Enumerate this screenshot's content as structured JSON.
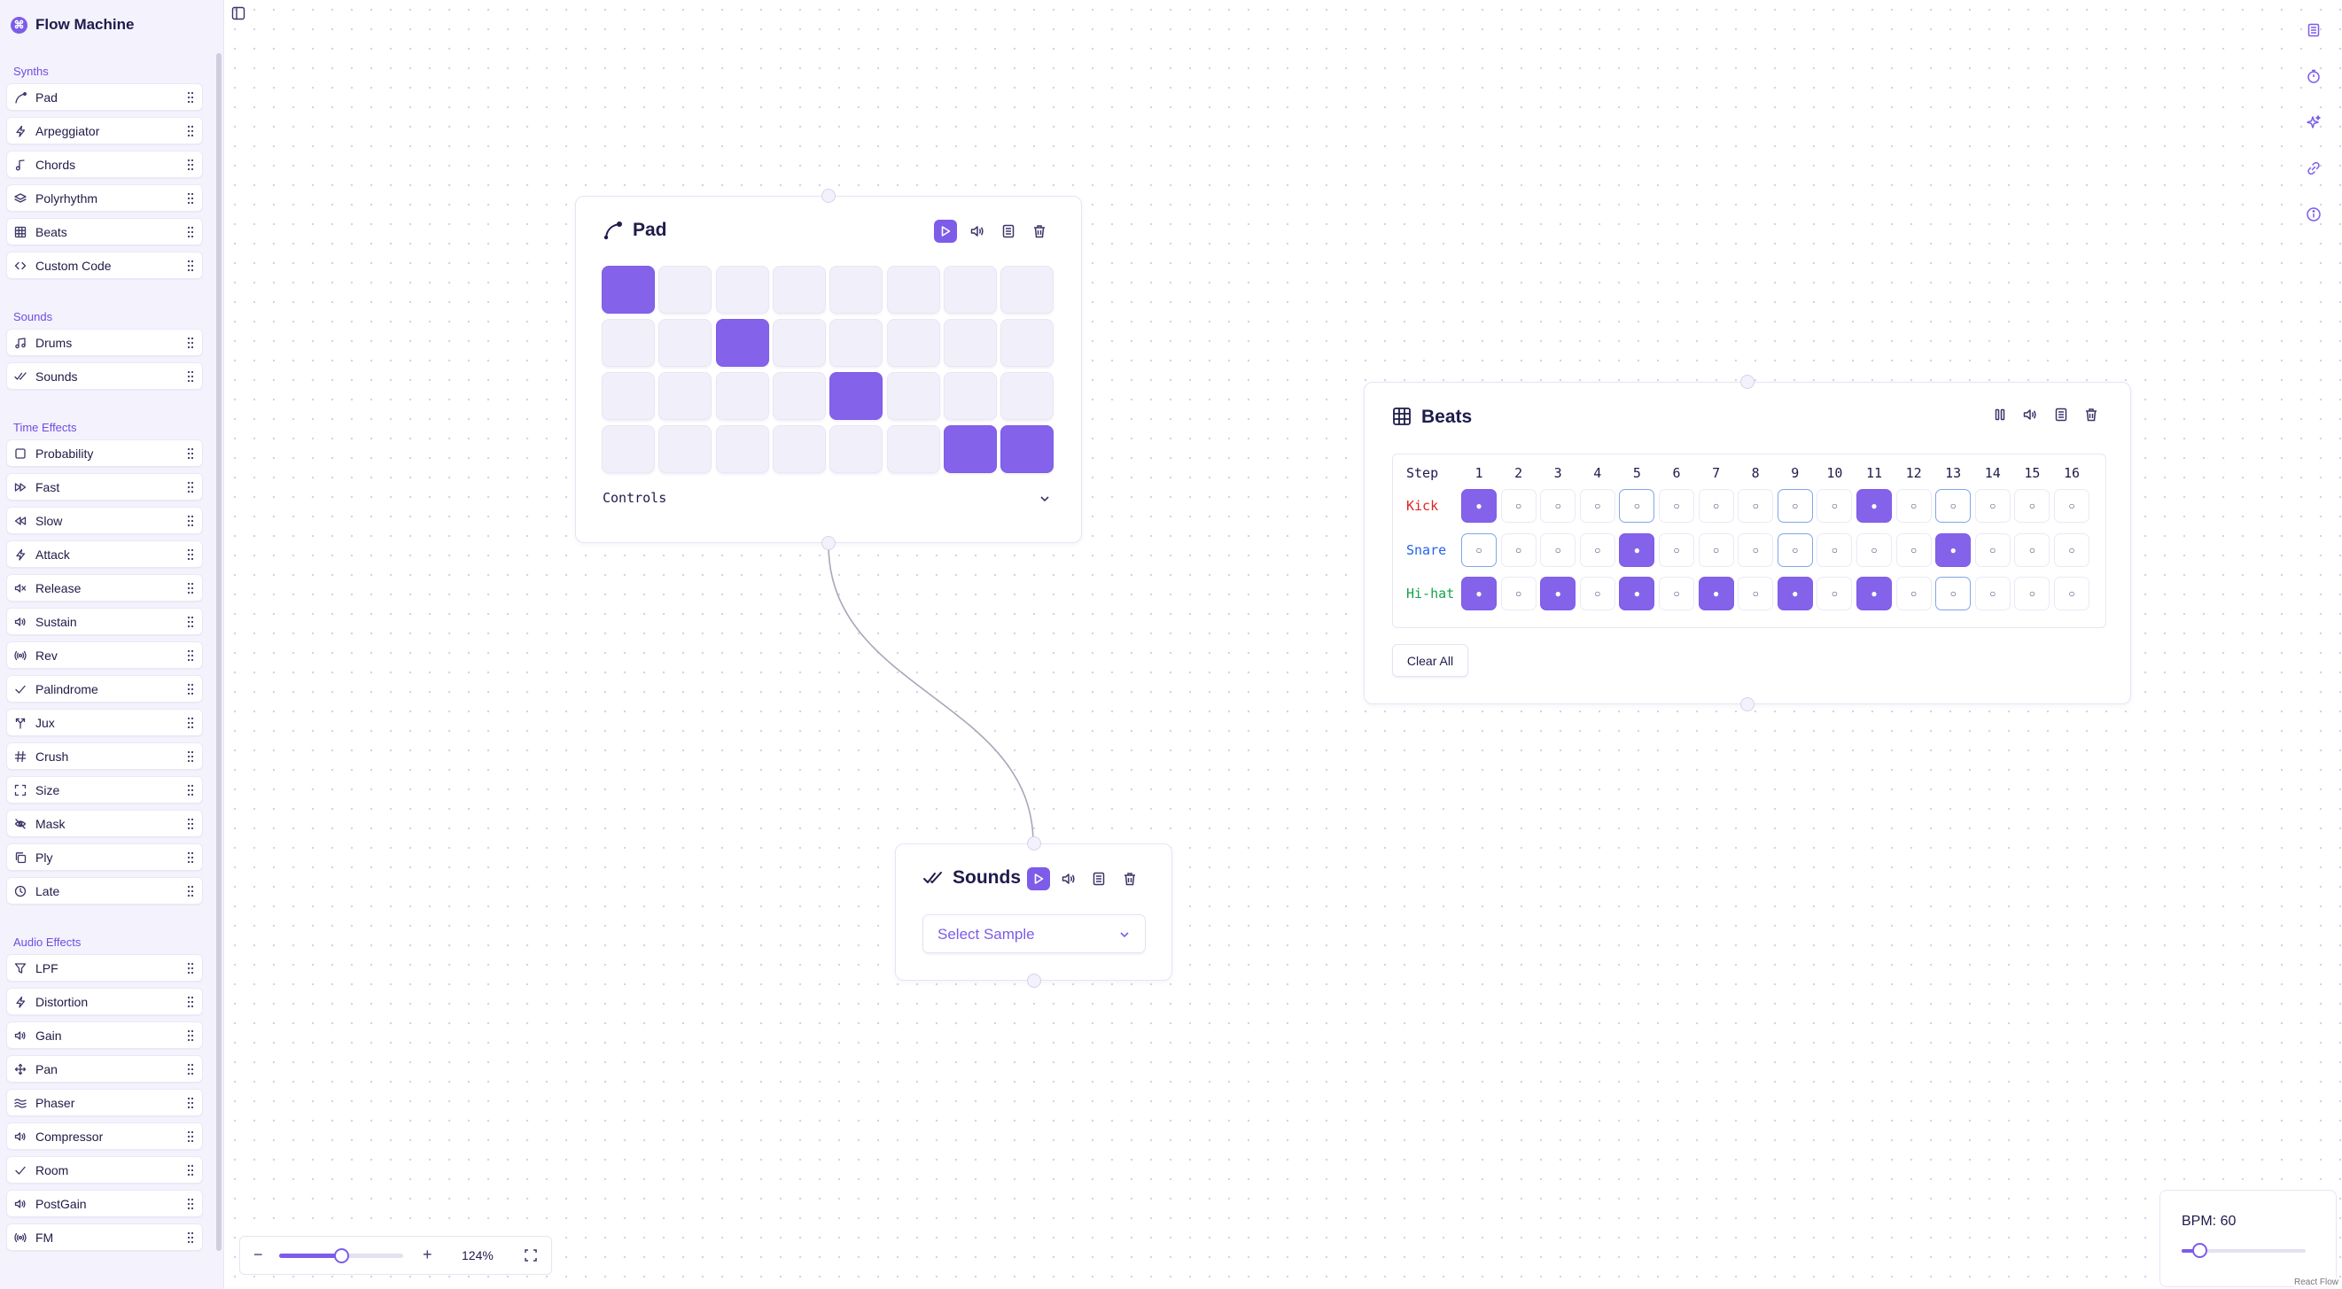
{
  "app": {
    "title": "Flow Machine",
    "logo_glyph": "⌘",
    "accent": "#7c5ce8"
  },
  "sidebar": {
    "sections": [
      {
        "title": "Synths",
        "items": [
          {
            "label": "Pad",
            "icon": "pen-curve-icon"
          },
          {
            "label": "Arpeggiator",
            "icon": "zap-icon"
          },
          {
            "label": "Chords",
            "icon": "music-note-icon"
          },
          {
            "label": "Polyrhythm",
            "icon": "layers-icon"
          },
          {
            "label": "Beats",
            "icon": "grid-icon"
          },
          {
            "label": "Custom Code",
            "icon": "code-icon"
          }
        ]
      },
      {
        "title": "Sounds",
        "items": [
          {
            "label": "Drums",
            "icon": "music-notes-icon"
          },
          {
            "label": "Sounds",
            "icon": "double-check-icon"
          }
        ]
      },
      {
        "title": "Time Effects",
        "items": [
          {
            "label": "Probability",
            "icon": "square-icon"
          },
          {
            "label": "Fast",
            "icon": "fast-forward-icon"
          },
          {
            "label": "Slow",
            "icon": "rewind-icon"
          },
          {
            "label": "Attack",
            "icon": "zap-icon"
          },
          {
            "label": "Release",
            "icon": "volume-x-icon"
          },
          {
            "label": "Sustain",
            "icon": "volume-icon"
          },
          {
            "label": "Rev",
            "icon": "radio-icon"
          },
          {
            "label": "Palindrome",
            "icon": "check-icon"
          },
          {
            "label": "Jux",
            "icon": "split-icon"
          },
          {
            "label": "Crush",
            "icon": "hash-icon"
          },
          {
            "label": "Size",
            "icon": "maximize-icon"
          },
          {
            "label": "Mask",
            "icon": "eye-off-icon"
          },
          {
            "label": "Ply",
            "icon": "copy-icon"
          },
          {
            "label": "Late",
            "icon": "clock-icon"
          }
        ]
      },
      {
        "title": "Audio Effects",
        "items": [
          {
            "label": "LPF",
            "icon": "filter-icon"
          },
          {
            "label": "Distortion",
            "icon": "zap-icon"
          },
          {
            "label": "Gain",
            "icon": "volume-icon"
          },
          {
            "label": "Pan",
            "icon": "move-icon"
          },
          {
            "label": "Phaser",
            "icon": "waves-icon"
          },
          {
            "label": "Compressor",
            "icon": "volume-icon"
          },
          {
            "label": "Room",
            "icon": "check-icon"
          },
          {
            "label": "PostGain",
            "icon": "volume-icon"
          },
          {
            "label": "FM",
            "icon": "radio-icon"
          }
        ]
      }
    ]
  },
  "pad_node": {
    "title": "Pad",
    "controls_label": "Controls",
    "grid": [
      [
        1,
        0,
        0,
        0,
        0,
        0,
        0,
        0
      ],
      [
        0,
        0,
        1,
        0,
        0,
        0,
        0,
        0
      ],
      [
        0,
        0,
        0,
        0,
        1,
        0,
        0,
        0
      ],
      [
        0,
        0,
        0,
        0,
        0,
        0,
        1,
        1
      ]
    ]
  },
  "beats_node": {
    "title": "Beats",
    "step_label": "Step",
    "steps": [
      "1",
      "2",
      "3",
      "4",
      "5",
      "6",
      "7",
      "8",
      "9",
      "10",
      "11",
      "12",
      "13",
      "14",
      "15",
      "16"
    ],
    "on_glyph": "●",
    "off_glyph": "○",
    "rows": [
      {
        "label": "Kick",
        "color": "#dc2626",
        "active": [
          1,
          11
        ],
        "highlight": [
          1,
          5,
          9,
          13
        ]
      },
      {
        "label": "Snare",
        "color": "#2563eb",
        "active": [
          5,
          13
        ],
        "highlight": [
          1,
          5,
          9,
          13
        ]
      },
      {
        "label": "Hi-hat",
        "color": "#16a34a",
        "active": [
          1,
          3,
          5,
          7,
          9,
          11
        ],
        "highlight": [
          13
        ]
      }
    ],
    "clear_label": "Clear All"
  },
  "sounds_node": {
    "title": "Sounds",
    "select_placeholder": "Select Sample"
  },
  "zoom": {
    "minus": "−",
    "plus": "+",
    "value_label": "124%",
    "level_fraction": 0.5
  },
  "bpm": {
    "label": "BPM: 60",
    "fraction": 0.14
  },
  "attribution": "React Flow"
}
